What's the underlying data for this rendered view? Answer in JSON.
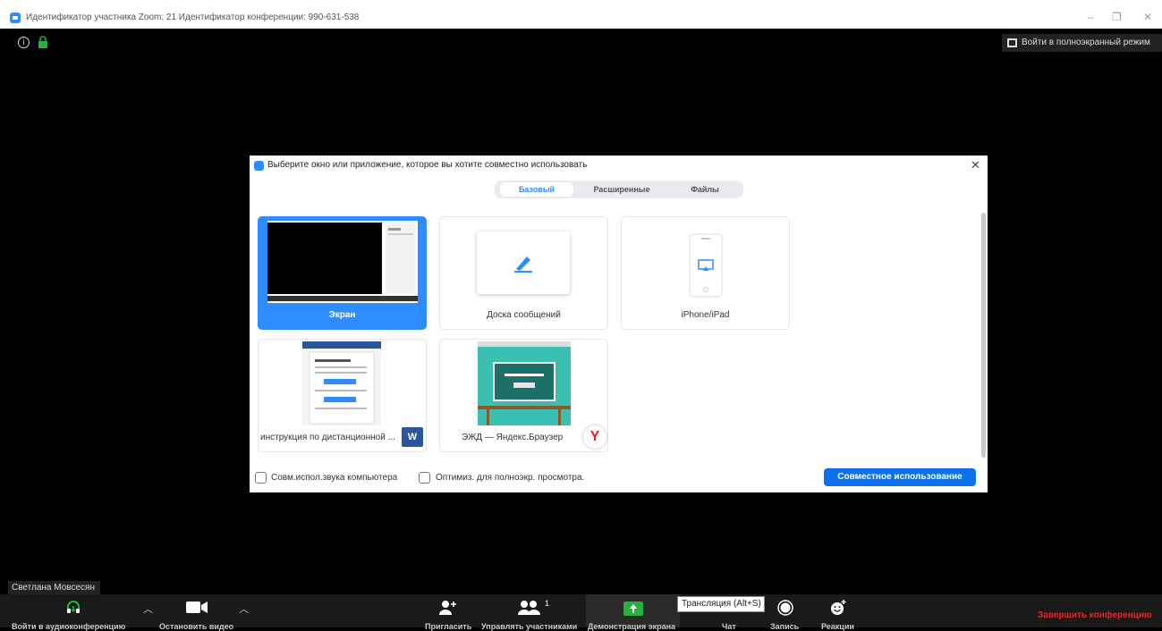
{
  "window": {
    "title": "Идентификатор участника Zoom: 21  Идентификатор конференции: 990-631-538",
    "controls": {
      "minimize": "–",
      "restore": "❐",
      "close": "✕"
    }
  },
  "meeting": {
    "fullscreen_label": "Войти в полноэкранный режим",
    "participant_name": "Светлана Мовсесян"
  },
  "share_dialog": {
    "title": "Выберите окно или приложение, которое вы хотите совместно использовать",
    "close": "✕",
    "tabs": [
      {
        "label": "Базовый",
        "active": true
      },
      {
        "label": "Расширенные",
        "active": false
      },
      {
        "label": "Файлы",
        "active": false
      }
    ],
    "tiles": [
      {
        "label": "Экран",
        "selected": true
      },
      {
        "label": "Доска сообщений",
        "selected": false
      },
      {
        "label": "iPhone/iPad",
        "selected": false
      },
      {
        "label": "инструкция по дистанционной ...",
        "selected": false,
        "app_icon": "W"
      },
      {
        "label": "ЭЖД — Яндекс.Браузер",
        "selected": false,
        "app_icon": "Y"
      }
    ],
    "options": [
      {
        "label": "Совм.испол.звука компьютера",
        "checked": false
      },
      {
        "label": "Оптимиз. для полноэкр. просмотра.",
        "checked": false
      }
    ],
    "share_button": "Совместное использование"
  },
  "toolbar": {
    "audio_label": "Войти в аудиоконференцию",
    "video_label": "Остановить видео",
    "invite_label": "Пригласить",
    "participants_label": "Управлять участниками",
    "participants_count": "1",
    "share_label": "Демонстрация экрана",
    "chat_label": "Чат",
    "record_label": "Запись",
    "reactions_label": "Реакции",
    "tooltip": "Трансляция (Alt+S)",
    "end_label": "Завершить конференцию"
  },
  "colors": {
    "accent": "#2d8cff",
    "end": "#e02828",
    "share_green": "#25b33e"
  }
}
